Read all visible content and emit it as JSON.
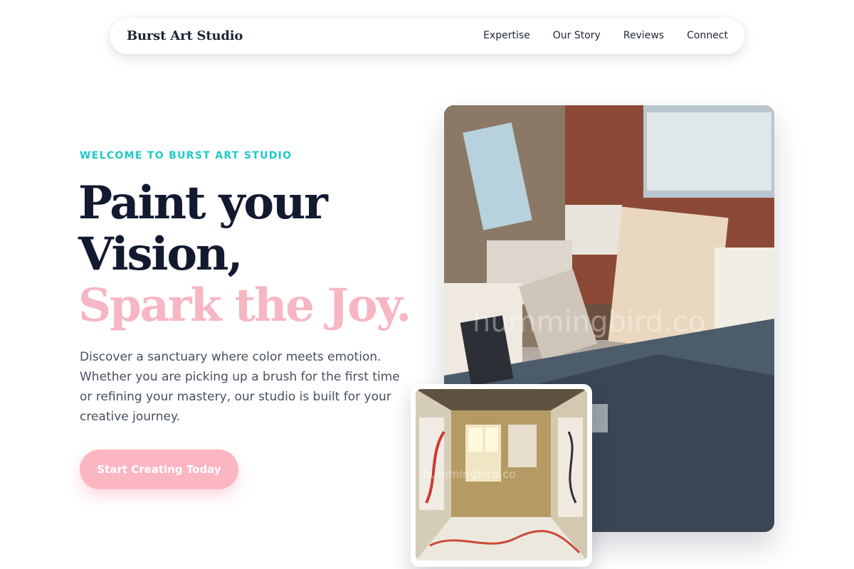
{
  "nav": {
    "brand": "Burst Art Studio",
    "links": [
      "Expertise",
      "Our Story",
      "Reviews",
      "Connect"
    ]
  },
  "hero": {
    "eyebrow": "WELCOME TO BURST ART STUDIO",
    "headline_line1": "Paint your",
    "headline_line2": "Vision,",
    "headline_accent": "Spark the Joy.",
    "description": "Discover a sanctuary where color meets emotion. Whether you are picking up a brush for the first time or refining your mastery, our studio is built for your creative journey.",
    "cta_label": "Start Creating Today"
  },
  "images": {
    "main_watermark": "hummingbird.co",
    "small_watermark": "hummingbird.co"
  },
  "colors": {
    "accent_teal": "#1fc8c8",
    "accent_pink": "#f7b6c3",
    "cta_pink": "#fbb6c1",
    "heading": "#121a30"
  }
}
